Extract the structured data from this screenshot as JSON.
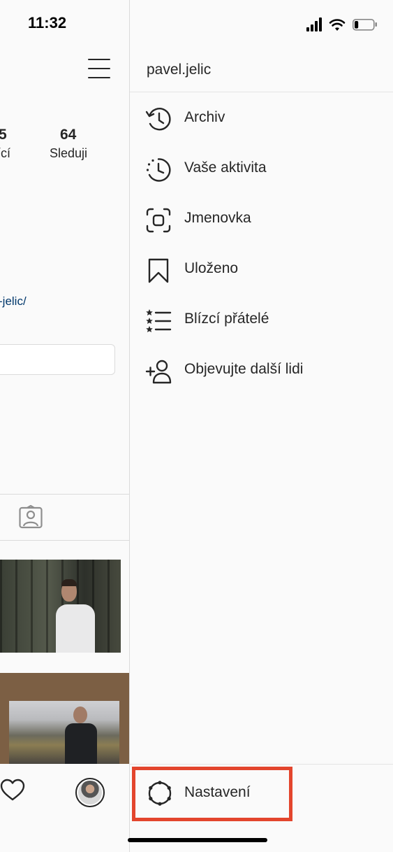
{
  "status_bar": {
    "time": "11:32",
    "battery_level": 0.2
  },
  "profile": {
    "stats": [
      {
        "number": "5",
        "label": "ící"
      },
      {
        "number": "64",
        "label": "Sleduji"
      }
    ],
    "link": "-jelic/"
  },
  "drawer": {
    "username": "pavel.jelic",
    "menu": [
      {
        "label": "Archiv",
        "icon": "archive-icon"
      },
      {
        "label": "Vaše aktivita",
        "icon": "activity-icon"
      },
      {
        "label": "Jmenovka",
        "icon": "nametag-icon"
      },
      {
        "label": "Uloženo",
        "icon": "bookmark-icon"
      },
      {
        "label": "Blízcí přátelé",
        "icon": "close-friends-icon"
      },
      {
        "label": "Objevujte další lidi",
        "icon": "add-person-icon"
      }
    ],
    "settings_label": "Nastavení",
    "highlight_color": "#e3452d"
  }
}
